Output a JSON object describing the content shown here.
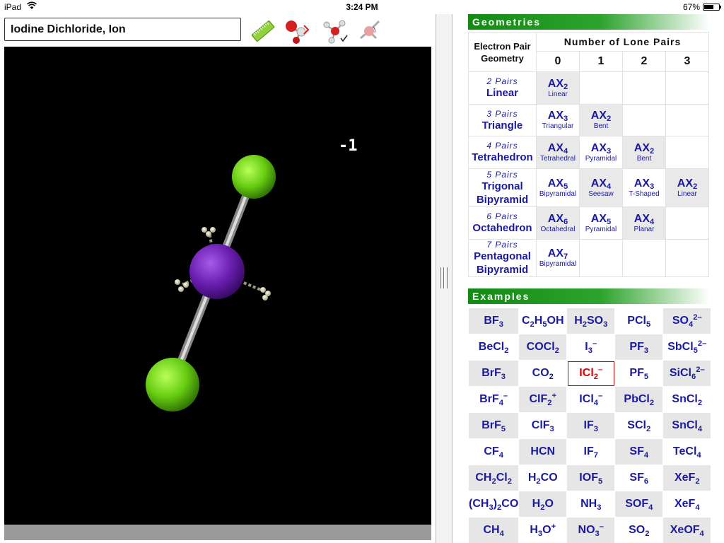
{
  "status_bar": {
    "carrier": "iPad",
    "time": "3:24 PM",
    "battery": "67%",
    "battery_level": 0.67
  },
  "molecule_title": "Iodine Dichloride, Ion",
  "toolbar": [
    {
      "name": "ruler-button",
      "icon": "ruler-icon"
    },
    {
      "name": "ball-and-stick-button",
      "icon": "ball-and-stick-model-icon"
    },
    {
      "name": "lone-pairs-button",
      "icon": "lone-pair-model-icon"
    },
    {
      "name": "bond-angle-button",
      "icon": "bond-angle-icon"
    }
  ],
  "viewer": {
    "charge": "-1",
    "atoms": [
      {
        "element": "Cl",
        "color": "#66cc11"
      },
      {
        "element": "I",
        "color": "#7a22b8"
      },
      {
        "element": "Cl",
        "color": "#66cc11"
      }
    ]
  },
  "colors": {
    "header_green": "#138a13",
    "label_blue": "#1a1aa0",
    "selected_red": "#e00000",
    "cell_gray": "#e9e9e9"
  },
  "geometries": {
    "header": "Geometries",
    "col_header": "Electron Pair Geometry",
    "lone_pair_header": "Number of Lone Pairs",
    "lone_pair_counts": [
      "0",
      "1",
      "2",
      "3"
    ],
    "rows": [
      {
        "pairs": "2 Pairs",
        "name": "Linear",
        "cells": [
          {
            "ax": "AX",
            "n": "2",
            "shape": "Linear"
          },
          null,
          null,
          null
        ]
      },
      {
        "pairs": "3 Pairs",
        "name": "Triangle",
        "cells": [
          {
            "ax": "AX",
            "n": "3",
            "shape": "Triangular"
          },
          {
            "ax": "AX",
            "n": "2",
            "shape": "Bent"
          },
          null,
          null
        ]
      },
      {
        "pairs": "4 Pairs",
        "name": "Tetrahedron",
        "cells": [
          {
            "ax": "AX",
            "n": "4",
            "shape": "Tetrahedral"
          },
          {
            "ax": "AX",
            "n": "3",
            "shape": "Pyramidal"
          },
          {
            "ax": "AX",
            "n": "2",
            "shape": "Bent"
          },
          null
        ]
      },
      {
        "pairs": "5 Pairs",
        "name": "Trigonal Bipyramid",
        "cells": [
          {
            "ax": "AX",
            "n": "5",
            "shape": "Bipyramidal"
          },
          {
            "ax": "AX",
            "n": "4",
            "shape": "Seesaw"
          },
          {
            "ax": "AX",
            "n": "3",
            "shape": "T-Shaped"
          },
          {
            "ax": "AX",
            "n": "2",
            "shape": "Linear"
          }
        ]
      },
      {
        "pairs": "6 Pairs",
        "name": "Octahedron",
        "cells": [
          {
            "ax": "AX",
            "n": "6",
            "shape": "Octahedral"
          },
          {
            "ax": "AX",
            "n": "5",
            "shape": "Pyramidal"
          },
          {
            "ax": "AX",
            "n": "4",
            "shape": "Planar"
          },
          null
        ]
      },
      {
        "pairs": "7 Pairs",
        "name": "Pentagonal Bipyramid",
        "cells": [
          {
            "ax": "AX",
            "n": "7",
            "shape": "Bipyramidal"
          },
          null,
          null,
          null
        ]
      }
    ]
  },
  "examples": {
    "header": "Examples",
    "selected": "ICl2-",
    "rows": [
      [
        "BF_3",
        "C_2H_5OH",
        "H_2SO_3",
        "PCl_5",
        "SO_4^2–"
      ],
      [
        "BeCl_2",
        "COCl_2",
        "I_3^–",
        "PF_3",
        "SbCl_5^2–"
      ],
      [
        "BrF_3",
        "CO_2",
        "ICl_2^–",
        "PF_5",
        "SiCl_6^2–"
      ],
      [
        "BrF_4^–",
        "ClF_2^+",
        "ICl_4^–",
        "PbCl_2",
        "SnCl_2"
      ],
      [
        "BrF_5",
        "ClF_3",
        "IF_3",
        "SCl_2",
        "SnCl_4"
      ],
      [
        "CF_4",
        "HCN",
        "IF_7",
        "SF_4",
        "TeCl_4"
      ],
      [
        "CH_2Cl_2",
        "H_2CO",
        "IOF_5",
        "SF_6",
        "XeF_2"
      ],
      [
        "(CH_3)_2CO",
        "H_2O",
        "NH_3",
        "SOF_4",
        "XeF_4"
      ],
      [
        "CH_4",
        "H_3O^+",
        "NO_3^–",
        "SO_2",
        "XeOF_4"
      ]
    ]
  }
}
